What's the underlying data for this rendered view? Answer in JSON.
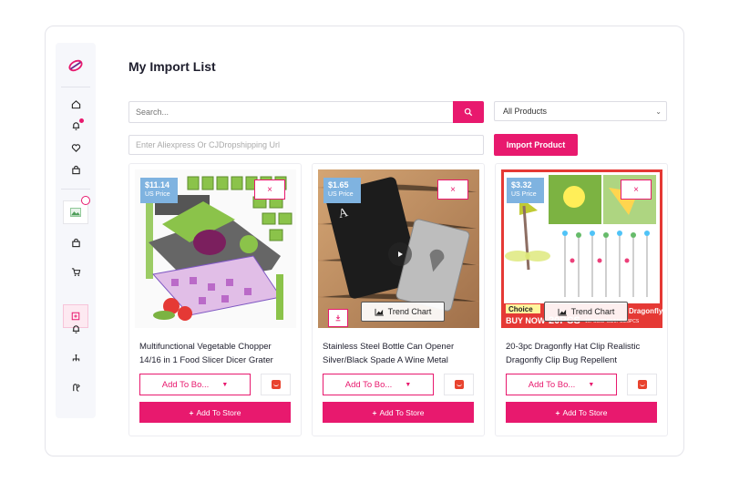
{
  "page": {
    "title": "My Import List"
  },
  "search": {
    "placeholder": "Search...",
    "icon": "search-icon"
  },
  "filter": {
    "selected": "All Products"
  },
  "url_input": {
    "placeholder": "Enter Aliexpress Or CJDropshipping Url"
  },
  "import_button": {
    "label": "Import Product"
  },
  "sidebar": {
    "icons": [
      "logo",
      "home-icon",
      "bell-icon",
      "heart-icon",
      "bag-icon",
      "product-thumb",
      "bag-icon",
      "cart-icon",
      "import-list-icon",
      "bell-icon",
      "sitemap-icon",
      "route-icon"
    ]
  },
  "colors": {
    "accent": "#e8196e",
    "price_tag": "#7fb3e0",
    "sidebar_bg": "#f6f7fb"
  },
  "cards": [
    {
      "price": "$11.14",
      "price_label": "US Price",
      "close": "×",
      "title": "Multifunctional Vegetable Chopper 14/16 in 1 Food Slicer Dicer Grater",
      "add_to_board": "Add To Bo...",
      "add_to_store": "Add To Store"
    },
    {
      "price": "$1.65",
      "price_label": "US Price",
      "close": "×",
      "trend": "Trend Chart",
      "title": "Stainless Steel Bottle Can Opener Silver/Black Spade A Wine Metal",
      "add_to_board": "Add To Bo...",
      "add_to_store": "Add To Store"
    },
    {
      "price": "$3.32",
      "price_label": "US Price",
      "close": "×",
      "trend": "Trend Chart",
      "title": "20-3pc Dragonfly Hat Clip Realistic Dragonfly Clip Bug Repellent",
      "add_to_board": "Add To Bo...",
      "add_to_store": "Add To Store",
      "image_text": {
        "choice": "Choice",
        "buy_now": "BUY NOW",
        "pcs": "20PCS",
        "sizes": "16PCS/8PCS/5PCS/3PCS",
        "banner": "Dragonfly"
      }
    }
  ]
}
